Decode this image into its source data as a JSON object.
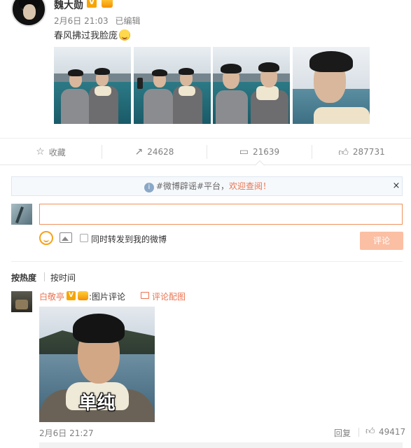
{
  "post": {
    "username": "魏大勋",
    "verified_badge": "V",
    "time": "2月6日 21:03",
    "edited": "已编辑",
    "text": "春风拂过我脸庞"
  },
  "actions": {
    "favorite": {
      "icon": "star-icon",
      "label": "收藏"
    },
    "repost": {
      "icon": "share-icon",
      "count": "24628"
    },
    "comment": {
      "icon": "comment-icon",
      "count": "21639"
    },
    "like": {
      "icon": "thumbs-up-icon",
      "count": "287731"
    }
  },
  "notice": {
    "info": "i",
    "text": "#微博辟谣#平台，",
    "link": "欢迎查阅！",
    "close": "×"
  },
  "composer": {
    "placeholder": "",
    "also_repost": "同时转发到我的微博",
    "submit": "评论"
  },
  "sort_tabs": {
    "hot": "按热度",
    "time": "按时间"
  },
  "comments": [
    {
      "user": "白敬亭",
      "verified_badge": "V",
      "text": ":图片评论",
      "image_comment": "评论配图",
      "image_caption": "单纯",
      "time": "2月6日 21:27",
      "reply": "回复",
      "likes": "49417"
    }
  ],
  "colors": {
    "accent": "#eb7350",
    "verified": "#f7a500",
    "input_border": "#f0935c",
    "submit_disabled": "#fbbfa4"
  }
}
